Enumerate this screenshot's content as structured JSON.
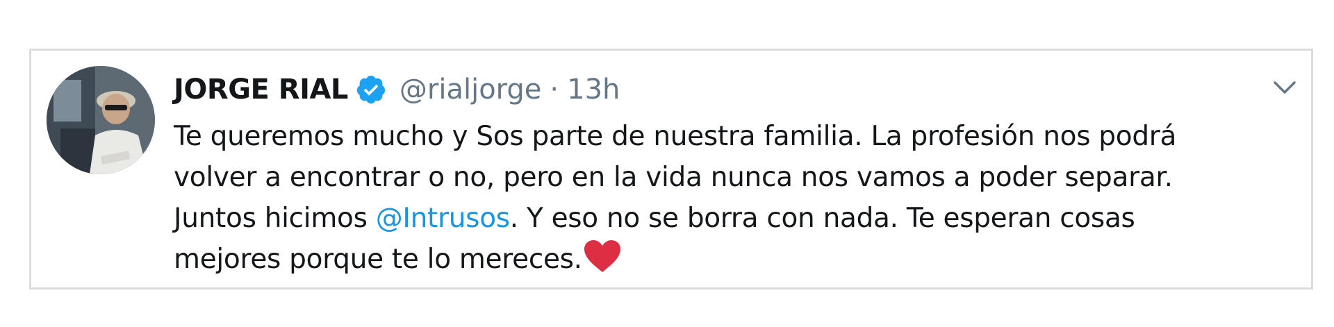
{
  "tweet": {
    "author_name": "JORGE RIAL",
    "handle": "@rialjorge",
    "separator": "·",
    "time": "13h",
    "lines": {
      "l1": "Te queremos mucho y Sos parte de nuestra familia. La profesión nos podrá",
      "l2": "volver a encontrar o no, pero en la vida nunca nos vamos a poder separar.",
      "l3_before": "Juntos hicimos ",
      "l3_mention": "@Intrusos",
      "l3_after": ". Y eso no se borra con nada. Te esperan cosas",
      "l4": "mejores porque te lo mereces."
    }
  },
  "icons": {
    "verified": "verified-badge-icon",
    "menu": "chevron-down-icon",
    "emoji": "red-heart-emoji"
  },
  "colors": {
    "name": "#14171a",
    "secondary": "#657786",
    "link": "#1b95e0",
    "verified": "#1da1f2",
    "heart": "#dd2e44",
    "border": "#dcdcdc"
  }
}
